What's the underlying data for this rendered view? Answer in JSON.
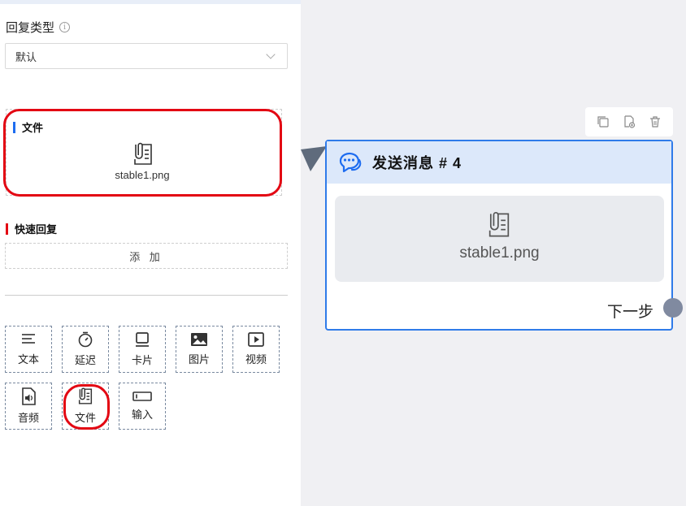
{
  "panel": {
    "reply_type_label": "回复类型",
    "info_icon": "info-icon",
    "reply_type_value": "默认"
  },
  "file_section": {
    "title": "文件",
    "icon": "file-clip-icon",
    "file_name": "stable1.png"
  },
  "quick_reply": {
    "title": "快速回复",
    "add_label": "添 加"
  },
  "tools": [
    {
      "label": "文本",
      "icon": "text-icon"
    },
    {
      "label": "延迟",
      "icon": "timer-icon"
    },
    {
      "label": "卡片",
      "icon": "card-icon"
    },
    {
      "label": "图片",
      "icon": "image-icon"
    },
    {
      "label": "视频",
      "icon": "video-icon"
    },
    {
      "label": "音频",
      "icon": "audio-icon"
    },
    {
      "label": "文件",
      "icon": "file-clip-icon"
    },
    {
      "label": "输入",
      "icon": "input-icon"
    }
  ],
  "node": {
    "title": "发送消息 # 4",
    "icon": "chat-bubble-icon",
    "file_name": "stable1.png",
    "next_label": "下一步"
  },
  "toolbar": {
    "icons": [
      "copy-icon",
      "duplicate-icon",
      "delete-icon"
    ]
  },
  "colors": {
    "accent_blue": "#2f7be9",
    "highlight_red": "#e30713",
    "node_header_bg": "#dce8fa",
    "canvas_bg": "#f0f0f3"
  }
}
